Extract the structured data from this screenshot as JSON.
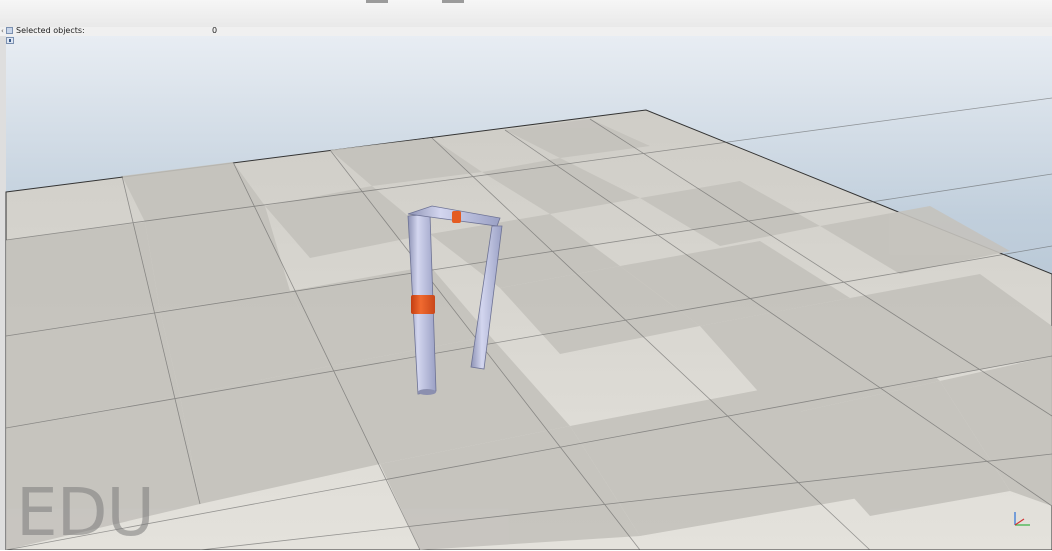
{
  "info": {
    "selected_label": "Selected objects:",
    "selected_value": "0"
  },
  "watermark": "EDU",
  "icons": [
    "collapse-arrow-icon",
    "info-toggle-icon",
    "axis-triad-icon"
  ],
  "colors": {
    "sky_top": "#e8edf3",
    "sky_bottom": "#9fb1c4",
    "floor_light": "#dedcd6",
    "floor_dark": "#c7c5bf",
    "link": "#b3b8d8",
    "joint": "#e8541e"
  }
}
